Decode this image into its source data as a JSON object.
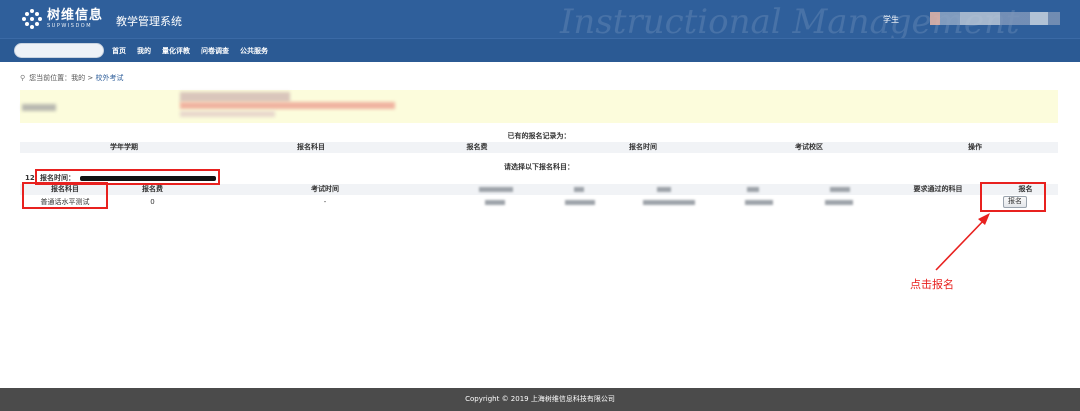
{
  "header": {
    "logo_cn": "树维信息",
    "logo_en": "SUPWISDOM",
    "system_title": "教学管理系统",
    "watermark": "Instructional Management",
    "role_label": "学生"
  },
  "nav": {
    "items": [
      "首页",
      "我的",
      "量化评教",
      "问卷调查",
      "公共服务"
    ]
  },
  "breadcrumb": {
    "prefix": "您当前位置：",
    "my": "我的",
    "separator": " > ",
    "current": "校外考试"
  },
  "records": {
    "title": "已有的报名记录为：",
    "columns": [
      "学年学期",
      "报名科目",
      "报名费",
      "报名时间",
      "考试校区",
      "操作"
    ]
  },
  "options": {
    "title": "请选择以下报名科目：",
    "index": "12",
    "time_label": "报名时间：",
    "columns": [
      "报名科目",
      "报名费",
      "考试时间",
      "要求通过的科目",
      "报名"
    ],
    "rows": [
      {
        "subject": "普通话水平测试",
        "fee": "0",
        "exam_time": "-",
        "action": "报名"
      }
    ]
  },
  "annotation": {
    "text": "点击报名",
    "color": "#e8211f"
  },
  "footer": {
    "text": "Copyright © 2019 上海树维信息科技有限公司"
  },
  "colors": {
    "header_bg": "#2f5f9b",
    "notice_bg": "#fcfcdc",
    "footer_bg": "#4b4b4b"
  }
}
